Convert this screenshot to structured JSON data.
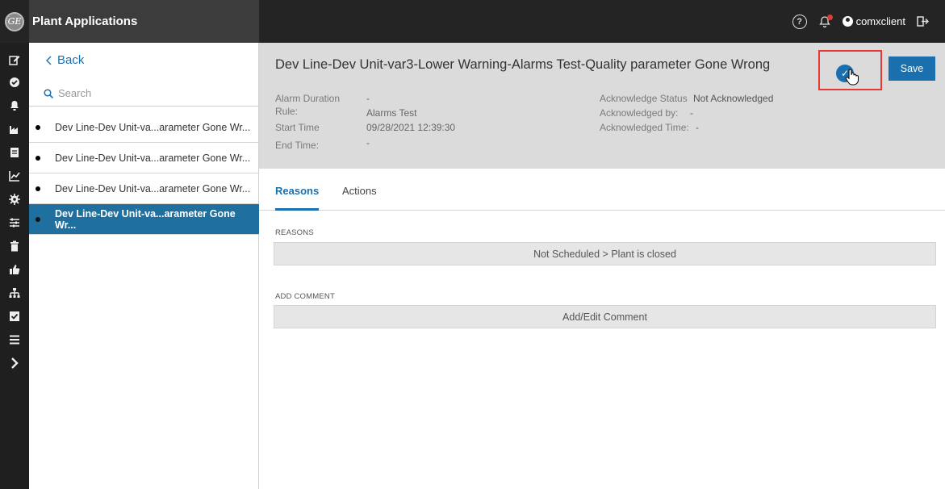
{
  "app": {
    "title": "Plant Applications",
    "logo_text": "GE"
  },
  "topbar": {
    "help_symbol": "?",
    "user_name": "comxclient"
  },
  "rail": {
    "icons": [
      "edit-icon",
      "check-circle-icon",
      "bell-icon",
      "factory-icon",
      "document-icon",
      "chart-icon",
      "gear-icon",
      "sliders-icon",
      "trash-icon",
      "thumbs-up-icon",
      "hierarchy-icon",
      "checkbox-icon",
      "list-icon",
      "chevron-right-icon"
    ]
  },
  "sidebar": {
    "back_label": "Back",
    "search_placeholder": "Search",
    "items": [
      {
        "label": "Dev Line-Dev Unit-va...arameter Gone Wr..."
      },
      {
        "label": "Dev Line-Dev Unit-va...arameter Gone Wr..."
      },
      {
        "label": "Dev Line-Dev Unit-va...arameter Gone Wr..."
      },
      {
        "label": "Dev Line-Dev Unit-va...arameter Gone Wr..."
      }
    ]
  },
  "detail": {
    "title": "Dev Line-Dev Unit-var3-Lower Warning-Alarms Test-Quality parameter Gone Wrong",
    "save_label": "Save",
    "ack_check": "✓",
    "fields_left": [
      {
        "label": "Alarm Duration",
        "value": "-"
      },
      {
        "label": "Rule:",
        "value": "Alarms Test"
      },
      {
        "label": "Start Time",
        "value": "09/28/2021 12:39:30"
      },
      {
        "label": "End Time:",
        "value": "-"
      }
    ],
    "fields_right": [
      {
        "label": "Acknowledge Status",
        "value": "Not Acknowledged"
      },
      {
        "label": "Acknowledged by:",
        "value": "-"
      },
      {
        "label": "Acknowledged Time:",
        "value": "-"
      }
    ]
  },
  "tabs": [
    {
      "label": "Reasons",
      "active": true
    },
    {
      "label": "Actions",
      "active": false
    }
  ],
  "reasons": {
    "section_label": "REASONS",
    "value": "Not Scheduled > Plant is closed",
    "comment_label": "ADD COMMENT",
    "comment_button": "Add/Edit Comment"
  },
  "colors": {
    "accent": "#1a6fae",
    "selected_row": "#1f6f9f",
    "highlight_box": "#e53935",
    "topbar": "#242424"
  }
}
